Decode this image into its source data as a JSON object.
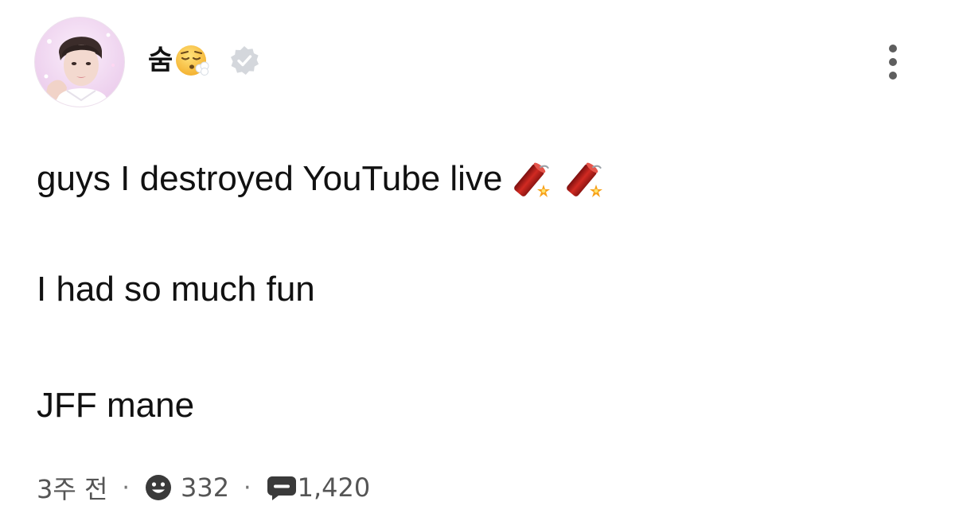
{
  "author": {
    "username": "숨",
    "username_emoji": "face-exhaling-icon",
    "verified_icon": "verified-badge-icon",
    "avatar": "profile-photo"
  },
  "post": {
    "lines": [
      "guys I destroyed YouTube live",
      "I had so much fun",
      "JFF mane"
    ],
    "line1_emojis": [
      "firecracker-icon",
      "firecracker-icon"
    ]
  },
  "meta": {
    "time": "3주 전",
    "separator": "·",
    "reaction_count": "332",
    "comment_count": "1,420"
  },
  "colors": {
    "text": "#111111",
    "meta_text": "#555555",
    "icon_dark": "#3a3a3a",
    "verified_gray": "#c9ccd1"
  }
}
